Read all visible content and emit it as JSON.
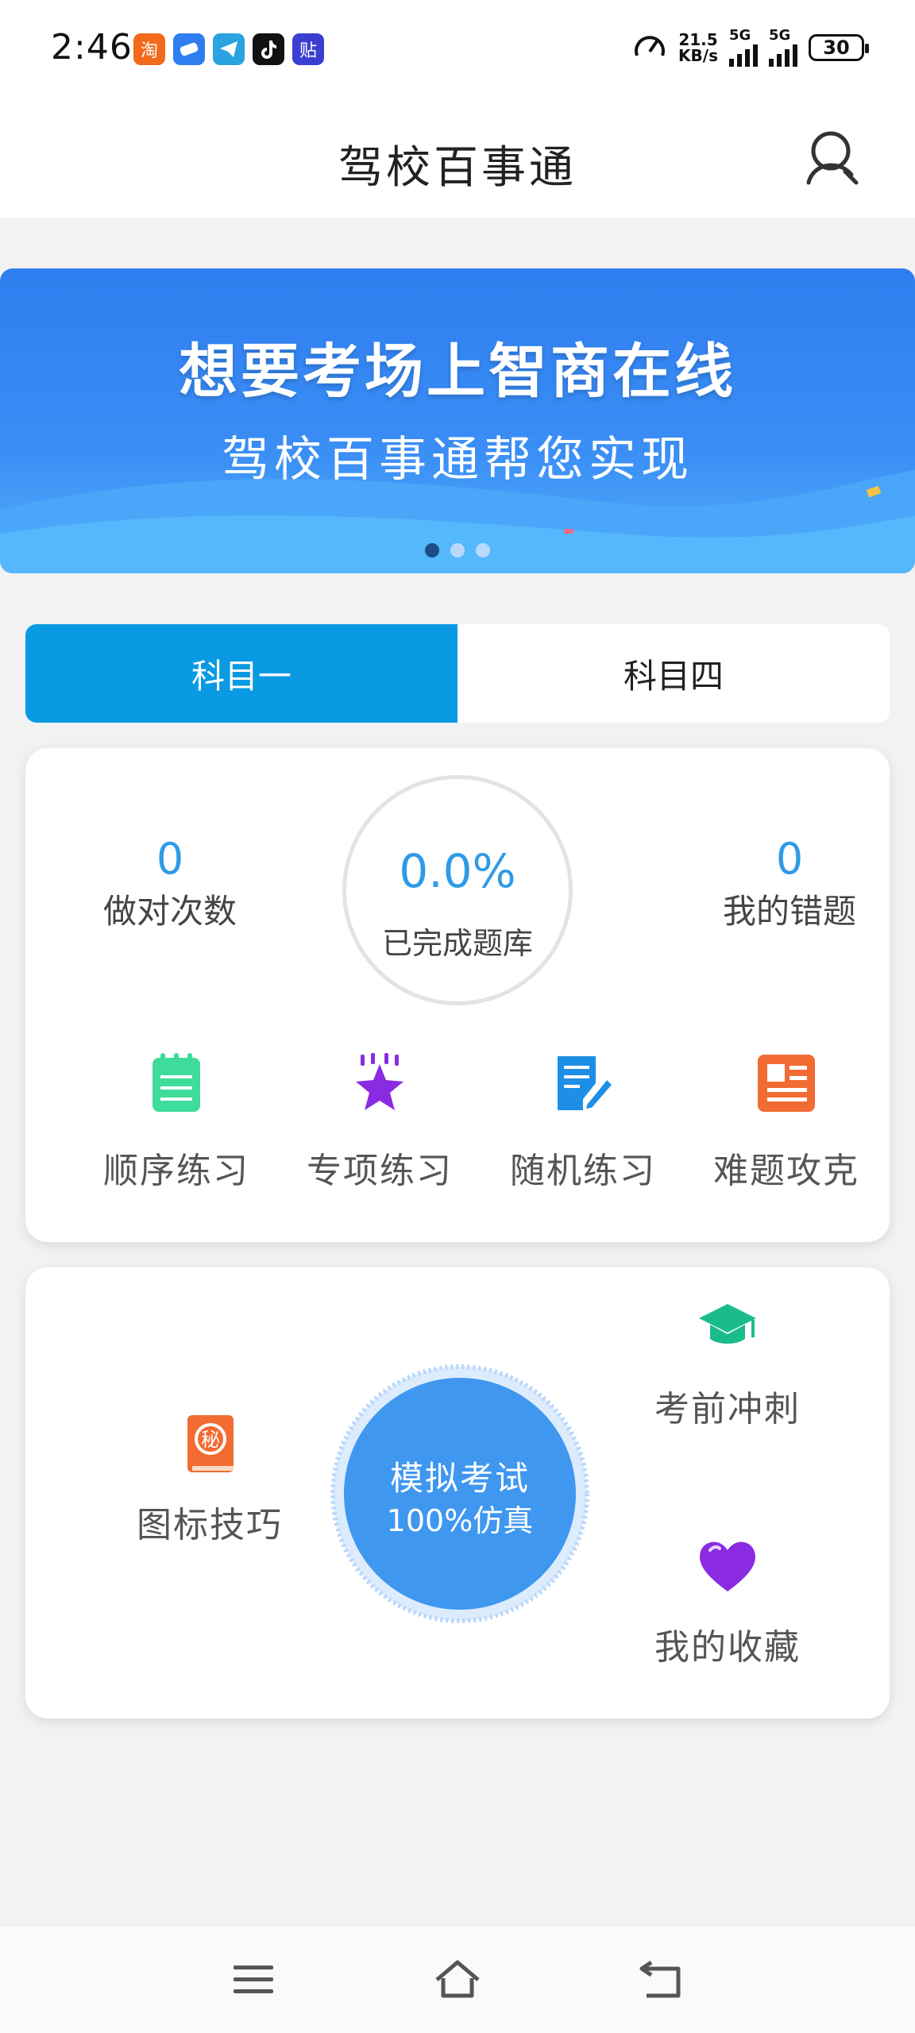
{
  "status_bar": {
    "time": "2:46",
    "app_icons": [
      {
        "icon": "taobao-icon",
        "glyph": "淘",
        "color": "#f26a1b"
      },
      {
        "icon": "browser-icon",
        "glyph": "",
        "color": "#2f7ef0"
      },
      {
        "icon": "telegram-icon",
        "glyph": "",
        "color": "#2aa3e0"
      },
      {
        "icon": "tiktok-icon",
        "glyph": "",
        "color": "#111111"
      },
      {
        "icon": "tieba-icon",
        "glyph": "贴",
        "color": "#3b3fd1"
      }
    ],
    "net_speed": "21.5",
    "net_unit": "KB/s",
    "sim1": "5G",
    "sim2": "5G",
    "battery": "30"
  },
  "header": {
    "title": "驾校百事通",
    "profile_icon": "user-icon"
  },
  "banner": {
    "title": "想要考场上智商在线",
    "subtitle": "驾校百事通帮您实现",
    "slide_count": 3,
    "active_slide": 1
  },
  "tabs": [
    {
      "label": "科目一",
      "active": true
    },
    {
      "label": "科目四",
      "active": false
    }
  ],
  "stats": {
    "correct_count": "0",
    "correct_label": "做对次数",
    "progress_value": "0.0%",
    "progress_label": "已完成题库",
    "wrong_count": "0",
    "wrong_label": "我的错题"
  },
  "practice": [
    {
      "label": "顺序练习",
      "icon": "notepad-icon",
      "color": "#3ddc9b"
    },
    {
      "label": "专项练习",
      "icon": "star-icon",
      "color": "#8a2be2"
    },
    {
      "label": "随机练习",
      "icon": "edit-doc-icon",
      "color": "#1e8fe6"
    },
    {
      "label": "难题攻克",
      "icon": "article-icon",
      "color": "#f26b32"
    }
  ],
  "exam": {
    "tips_label": "图标技巧",
    "tips_glyph": "秘",
    "sprint_label": "考前冲刺",
    "favorites_label": "我的收藏",
    "mock_line1": "模拟考试",
    "mock_line2": "100%仿真"
  },
  "colors": {
    "accent": "#0a9ae3",
    "stat_blue": "#2f9ae6",
    "mock_button": "#3f97ef"
  }
}
